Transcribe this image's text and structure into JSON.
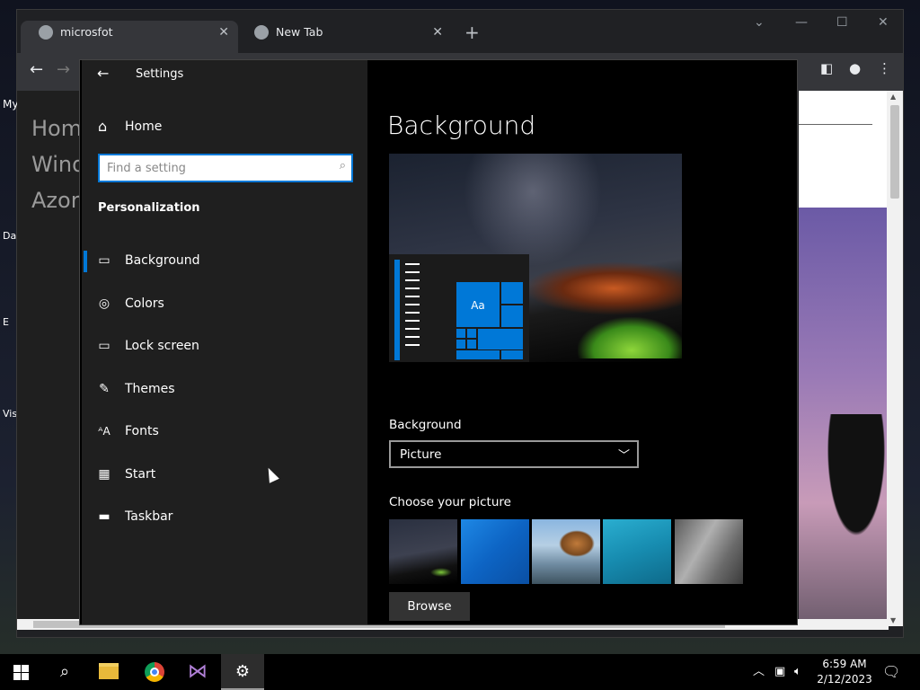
{
  "browser": {
    "tabs": [
      {
        "label": "microsfot",
        "close": "✕"
      },
      {
        "label": "New Tab",
        "close": "✕"
      }
    ],
    "new_tab": "+",
    "toolbar_partial_text": "My",
    "page_left_partial": [
      "Hom",
      "Wind",
      "Azor"
    ],
    "desktop_partial_labels": [
      "Da",
      "E",
      "Vis"
    ]
  },
  "settings": {
    "title": "Settings",
    "home_label": "Home",
    "search_placeholder": "Find a setting",
    "section_title": "Personalization",
    "nav_items": [
      {
        "label": "Background",
        "icon": "picture-icon",
        "selected": true
      },
      {
        "label": "Colors",
        "icon": "palette-icon"
      },
      {
        "label": "Lock screen",
        "icon": "lock-screen-icon"
      },
      {
        "label": "Themes",
        "icon": "themes-icon"
      },
      {
        "label": "Fonts",
        "icon": "fonts-icon"
      },
      {
        "label": "Start",
        "icon": "start-icon"
      },
      {
        "label": "Taskbar",
        "icon": "taskbar-icon"
      }
    ],
    "main": {
      "heading": "Background",
      "preview_tile_text": "Aa",
      "background_label": "Background",
      "background_value": "Picture",
      "choose_picture_label": "Choose your picture",
      "browse_label": "Browse"
    }
  },
  "taskbar": {
    "time": "6:59 AM",
    "date": "2/12/2023"
  },
  "colors": {
    "accent": "#0078d7",
    "sidebar_bg": "#1f1f1f",
    "main_bg": "#000000"
  }
}
